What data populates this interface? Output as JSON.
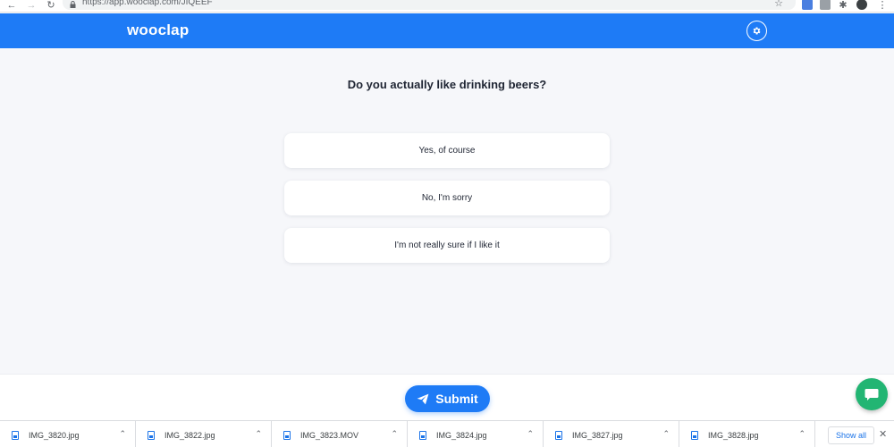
{
  "browser": {
    "url": "https://app.wooclap.com/JIQEEF"
  },
  "header": {
    "logo_text": "wooclap",
    "accent_color": "#1e7bf6"
  },
  "question": {
    "text": "Do you actually like drinking beers?",
    "choices": [
      "Yes, of course",
      "No, I'm sorry",
      "I'm not really sure if I like it"
    ]
  },
  "footer": {
    "submit_label": "Submit",
    "chat_color": "#22b573"
  },
  "downloads": {
    "files": [
      "IMG_3820.jpg",
      "IMG_3822.jpg",
      "IMG_3823.MOV",
      "IMG_3824.jpg",
      "IMG_3827.jpg",
      "IMG_3828.jpg"
    ],
    "show_all_label": "Show all"
  }
}
